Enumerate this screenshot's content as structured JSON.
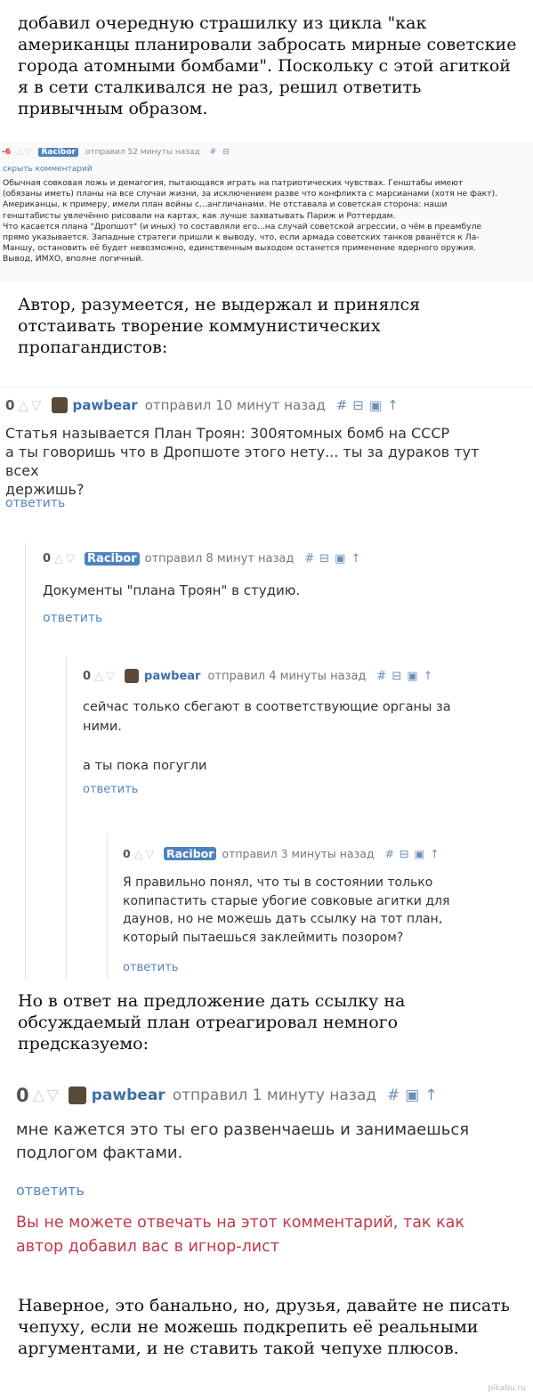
{
  "narrative": {
    "intro": "добавил очередную страшилку из цикла \"как американцы планировали забросать мирные советские города атомными бомбами\". Поскольку с этой агиткой я в сети сталкивался не раз, решил ответить привычным образом.",
    "mid": "Автор, разумеется, не выдержал и принялся отстаивать творение коммунистических пропагандистов:",
    "after": "Но в ответ на предложение дать ссылку на обсуждаемый план отреагировал немного предсказуемо:",
    "outro": "Наверное, это банально, но, друзья, давайте не писать чепуху, если не можешь подкрепить её реальными аргументами, и не ставить такой чепухе плюсов."
  },
  "quoted_comment": {
    "rating": "-6",
    "user": "Racibor",
    "meta": "отправил 52 минуты назад",
    "hide_label": "скрыть комментарий",
    "text": "Обычная совковая ложь и демагогия, пытающаяся играть на патриотических чувствах. Генштабы имеют\n(обязаны иметь) планы на все случаи жизни, за исключением разве что конфликта с марсианами (хотя не факт).\nАмериканцы, к примеру, имели план войны с...англичанами. Не отставала и советская сторона: наши\nгенштабисты увлечённо рисовали на картах, как лучше захватывать Париж и Роттердам.\nЧто касается плана \"Дропшот\" (и иных) то составляли его...на случай советской агрессии, о чём в преамбуле\nпрямо указывается. Западные стратеги пришли к выводу, что, если армада советских танков рванётся к Ла-\nМаншу, остановить её будет невозможно, единственным выходом останется применение ядерного оружия.\nВывод, ИМХО, вполне логичный."
  },
  "comments": [
    {
      "rating": "0",
      "user": "pawbear",
      "meta": "отправил 10 минут назад",
      "text": "Статья называется План Троян: 300ятомных бомб на СССР\nа ты говоришь что в Дропшоте этого нету... ты за дураков тут всех\nдержишь?",
      "reply_label": "ответить"
    },
    {
      "rating": "0",
      "user": "Racibor",
      "meta": "отправил 8 минут назад",
      "text": "Документы \"плана Троян\" в студию.",
      "reply_label": "ответить"
    },
    {
      "rating": "0",
      "user": "pawbear",
      "meta": "отправил 4 минуты назад",
      "text": "сейчас только сбегают в соответствующие органы за\nними.\n\nа ты пока погугли",
      "reply_label": "ответить"
    },
    {
      "rating": "0",
      "user": "Racibor",
      "meta": "отправил 3 минуты назад",
      "text": "Я правильно понял, что ты в состоянии только\nкопипастить старые убогие совковые агитки для\nдаунов, но не можешь дать ссылку на тот план,\nкоторый пытаешься заклеймить позором?",
      "reply_label": "ответить"
    },
    {
      "rating": "0",
      "user": "pawbear",
      "meta": "отправил 1 минуту назад",
      "text": "мне кажется это ты его развенчаешь и занимаешься\nподлогом фактами.",
      "reply_label": "ответить",
      "ignore_notice": "Вы не можете отвечать на этот комментарий, так как\nавтор добавил вас в игнор-лист"
    }
  ],
  "icons": {
    "vote_up": "triangle-up-icon",
    "vote_down": "triangle-down-icon",
    "link": "hash-icon",
    "collapse": "minus-box-icon",
    "save": "floppy-icon",
    "parent": "arrow-up-icon"
  },
  "watermark": "pikabu.ru",
  "colors": {
    "username": "#3a6fa8",
    "badge": "#4d83be",
    "reply_link": "#5686bf",
    "warning": "#c0394b"
  }
}
